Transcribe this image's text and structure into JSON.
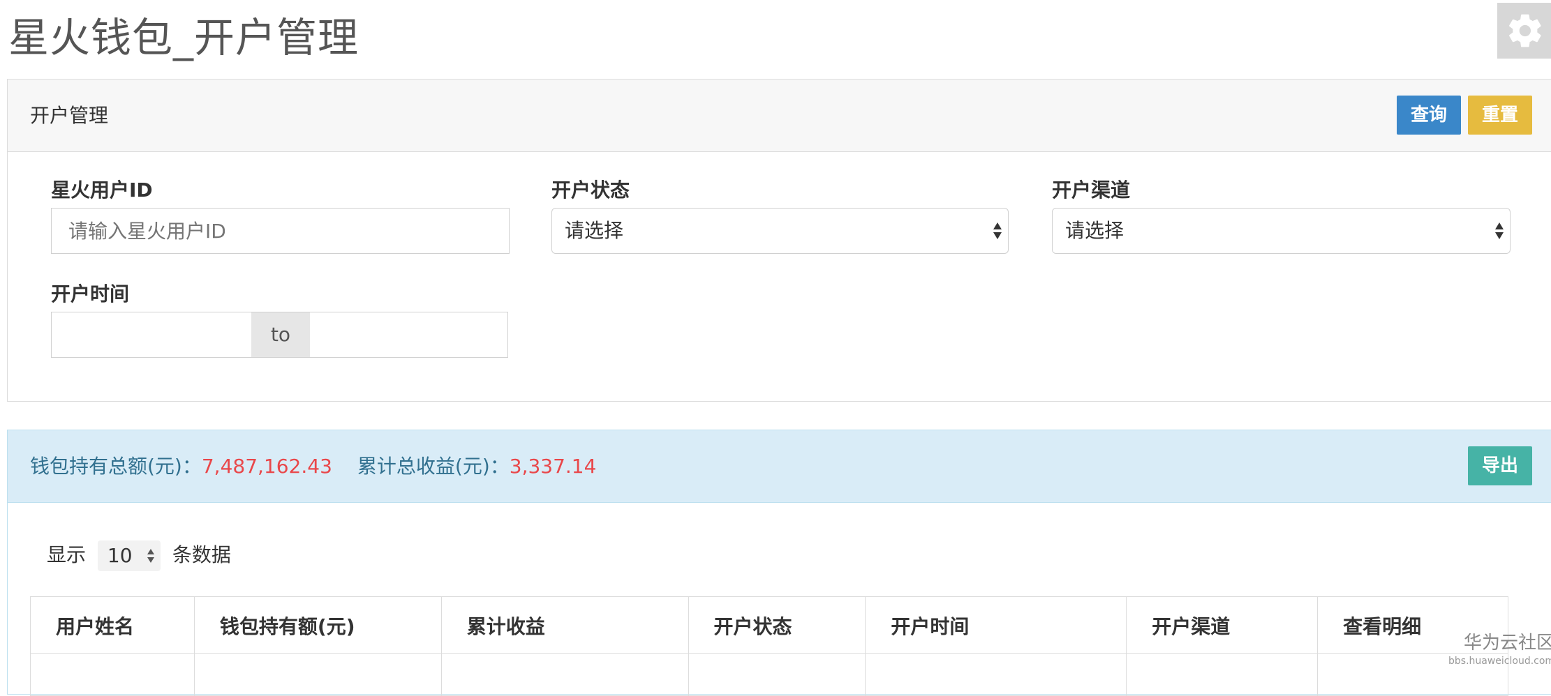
{
  "page": {
    "title": "星火钱包_开户管理"
  },
  "header": {
    "settings_icon": "gear-icon"
  },
  "search_panel": {
    "title": "开户管理",
    "query_label": "查询",
    "reset_label": "重置",
    "fields": {
      "user_id": {
        "label": "星火用户ID",
        "placeholder": "请输入星火用户ID"
      },
      "status": {
        "label": "开户状态",
        "value": "请选择"
      },
      "channel": {
        "label": "开户渠道",
        "value": "请选择"
      },
      "time": {
        "label": "开户时间",
        "separator": "to"
      }
    }
  },
  "summary": {
    "total_label": "钱包持有总额(元)：",
    "total_value": "7,487,162.43",
    "income_label": "累计总收益(元)：",
    "income_value": "3,337.14",
    "export_label": "导出"
  },
  "table_controls": {
    "show_label": "显示",
    "page_size": "10",
    "rows_label": "条数据"
  },
  "table": {
    "columns": [
      "用户姓名",
      "钱包持有额(元)",
      "累计收益",
      "开户状态",
      "开户时间",
      "开户渠道",
      "查看明细"
    ]
  },
  "watermark": {
    "name": "华为云社区",
    "url": "bbs.huaweicloud.com"
  },
  "colors": {
    "primary": "#3a87c9",
    "warning": "#e6bb3f",
    "success": "#46b3a6",
    "highlight": "#e9474a",
    "info_bg": "#d9ecf7"
  }
}
